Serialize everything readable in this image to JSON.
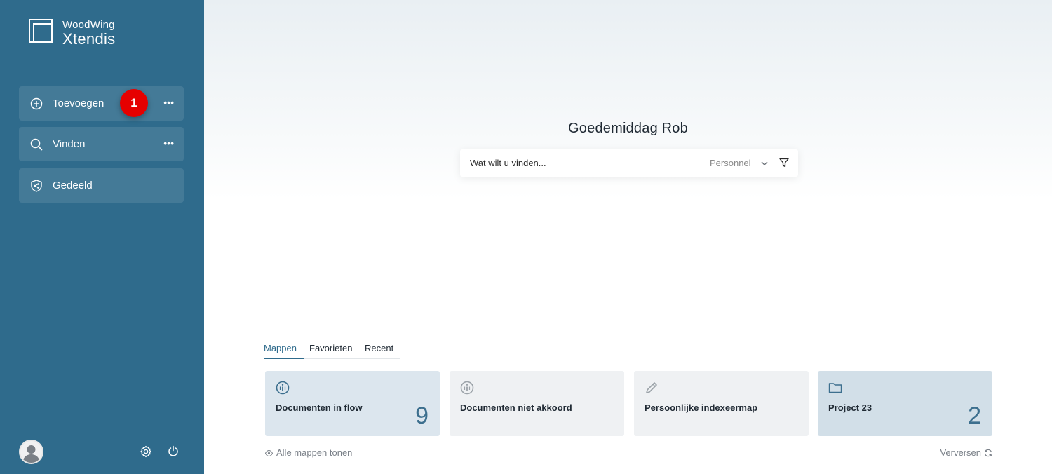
{
  "brand": {
    "company": "WoodWing",
    "product": "Xtendis"
  },
  "sidebar": {
    "items": [
      {
        "label": "Toevoegen",
        "icon": "plus-circle-icon",
        "more": "•••"
      },
      {
        "label": "Vinden",
        "icon": "search-icon",
        "more": "•••"
      },
      {
        "label": "Gedeeld",
        "icon": "shield-share-icon"
      }
    ],
    "badge": "1",
    "footer": {
      "avatar": "user-avatar",
      "settings": "gear-icon",
      "power": "power-icon"
    }
  },
  "main": {
    "greeting": "Goedemiddag Rob",
    "search": {
      "placeholder": "Wat wilt u vinden...",
      "scope": "Personnel"
    },
    "tabs": [
      {
        "label": "Mappen",
        "active": true
      },
      {
        "label": "Favorieten",
        "active": false
      },
      {
        "label": "Recent",
        "active": false
      }
    ],
    "cards": [
      {
        "title": "Documenten in flow",
        "count": "9",
        "icon": "info-circle-icon"
      },
      {
        "title": "Documenten niet akkoord",
        "count": "",
        "icon": "info-circle-icon"
      },
      {
        "title": "Persoonlijke indexeermap",
        "count": "",
        "icon": "pencil-icon"
      },
      {
        "title": "Project 23",
        "count": "2",
        "icon": "folder-icon"
      }
    ],
    "show_all": "Alle mappen tonen",
    "refresh": "Verversen"
  },
  "colors": {
    "sidebar_bg": "#2f6b8c",
    "accent": "#2f6b8c",
    "badge": "#e60000",
    "card_highlight": "#dce6ee",
    "card_neutral": "#eff1f3"
  }
}
